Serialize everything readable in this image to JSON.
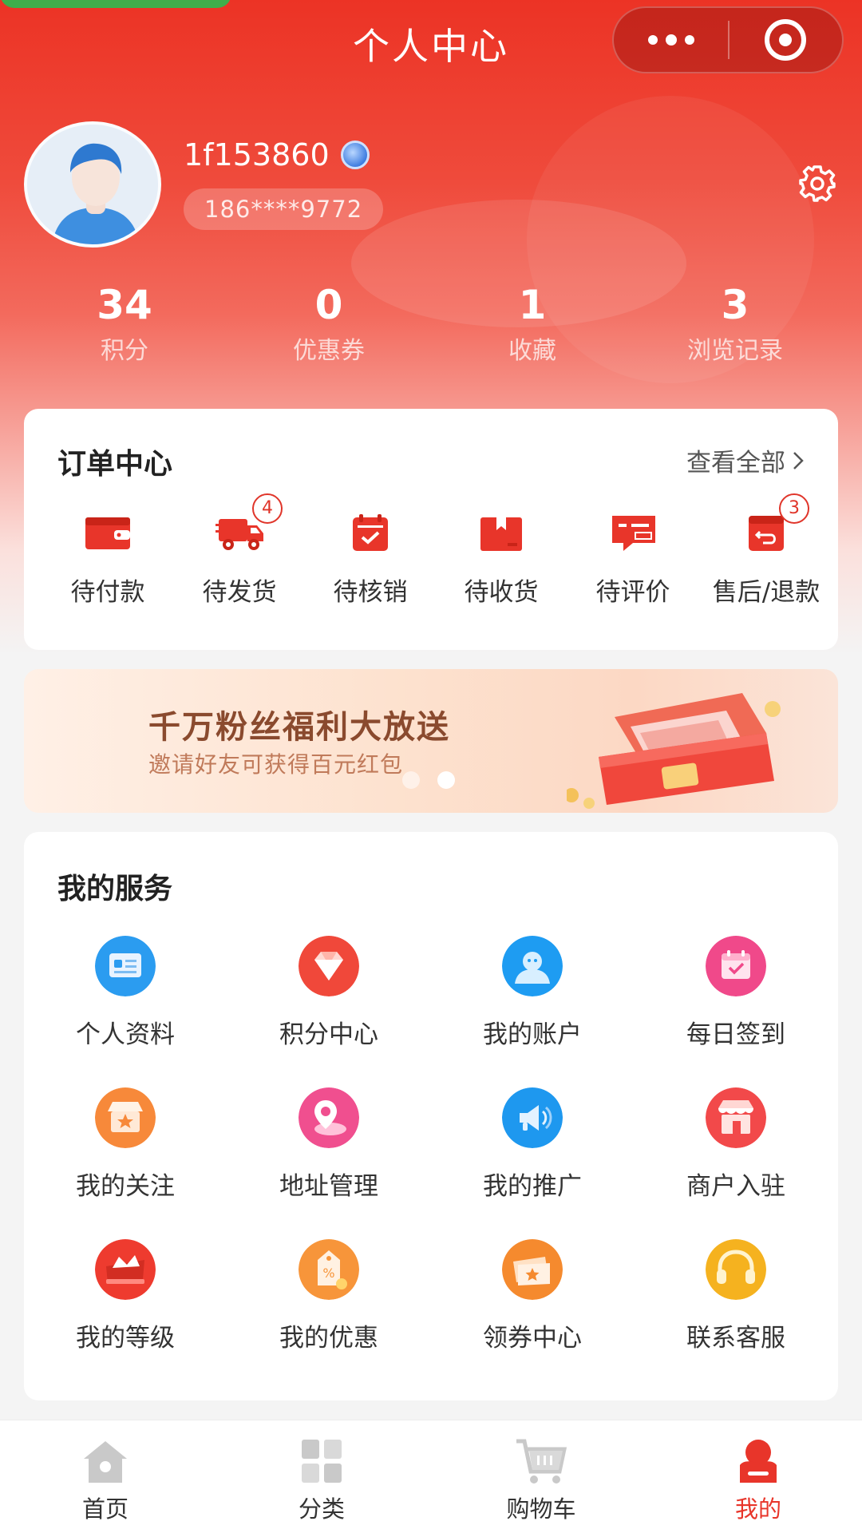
{
  "header": {
    "title": "个人中心"
  },
  "user": {
    "name": "1f153860",
    "phone": "186****9772"
  },
  "stats": [
    {
      "value": "34",
      "label": "积分"
    },
    {
      "value": "0",
      "label": "优惠券"
    },
    {
      "value": "1",
      "label": "收藏"
    },
    {
      "value": "3",
      "label": "浏览记录"
    }
  ],
  "orders": {
    "title": "订单中心",
    "view_all": "查看全部",
    "items": [
      {
        "label": "待付款",
        "icon": "wallet-icon"
      },
      {
        "label": "待发货",
        "icon": "truck-icon",
        "badge": "4"
      },
      {
        "label": "待核销",
        "icon": "calendar-check-icon"
      },
      {
        "label": "待收货",
        "icon": "box-icon"
      },
      {
        "label": "待评价",
        "icon": "comment-icon"
      },
      {
        "label": "售后/退款",
        "icon": "return-icon",
        "badge": "3"
      }
    ]
  },
  "banner": {
    "title": "千万粉丝福利大放送",
    "subtitle": "邀请好友可获得百元红包"
  },
  "services": {
    "title": "我的服务",
    "items": [
      {
        "label": "个人资料",
        "icon": "profile-card-icon",
        "color": "#2b9cf0"
      },
      {
        "label": "积分中心",
        "icon": "diamond-icon",
        "color": "#f0483a"
      },
      {
        "label": "我的账户",
        "icon": "account-icon",
        "color": "#1e9cf2"
      },
      {
        "label": "每日签到",
        "icon": "calendar-icon",
        "color": "#f0498a"
      },
      {
        "label": "我的关注",
        "icon": "store-star-icon",
        "color": "#f7893a"
      },
      {
        "label": "地址管理",
        "icon": "location-pin-icon",
        "color": "#f04f8f"
      },
      {
        "label": "我的推广",
        "icon": "megaphone-icon",
        "color": "#1e98ef"
      },
      {
        "label": "商户入驻",
        "icon": "shop-icon",
        "color": "#f2494a"
      },
      {
        "label": "我的等级",
        "icon": "crown-icon",
        "color": "#ee3b2f"
      },
      {
        "label": "我的优惠",
        "icon": "discount-tag-icon",
        "color": "#f7953a"
      },
      {
        "label": "领券中心",
        "icon": "coupon-icon",
        "color": "#f58a2e"
      },
      {
        "label": "联系客服",
        "icon": "headset-icon",
        "color": "#f5b21f"
      }
    ]
  },
  "tabbar": [
    {
      "label": "首页",
      "icon": "home-icon"
    },
    {
      "label": "分类",
      "icon": "category-icon"
    },
    {
      "label": "购物车",
      "icon": "cart-icon"
    },
    {
      "label": "我的",
      "icon": "user-icon",
      "active": true
    }
  ]
}
